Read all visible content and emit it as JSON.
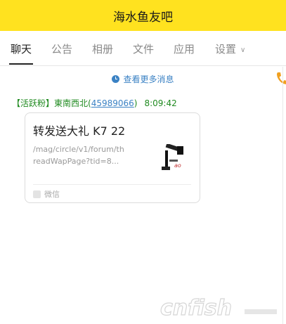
{
  "header": {
    "title": "海水鱼友吧"
  },
  "tabs": [
    {
      "label": "聊天",
      "active": true
    },
    {
      "label": "公告"
    },
    {
      "label": "相册"
    },
    {
      "label": "文件"
    },
    {
      "label": "应用"
    },
    {
      "label": "设置"
    }
  ],
  "history": {
    "more_label": "查看更多消息"
  },
  "message": {
    "badge": "【活跃粉】",
    "nickname": "東南西北",
    "uid_open": "(",
    "uid": "45989066",
    "uid_close": ")",
    "time": "8:09:42",
    "card": {
      "title": "转发送大礼 K7 22",
      "url_text": "/mag/circle/v1/forum/threadWapPage?tid=8...",
      "source": "微信"
    }
  },
  "watermark": {
    "text": "cnfish"
  },
  "colors": {
    "header_bg": "#ffe21f",
    "link": "#3b82c4",
    "sender_green": "#1f8a1f",
    "phone_orange": "#f0a020"
  },
  "icons": [
    "clock-icon",
    "chevron-down-icon",
    "phone-icon",
    "wechat-icon"
  ]
}
